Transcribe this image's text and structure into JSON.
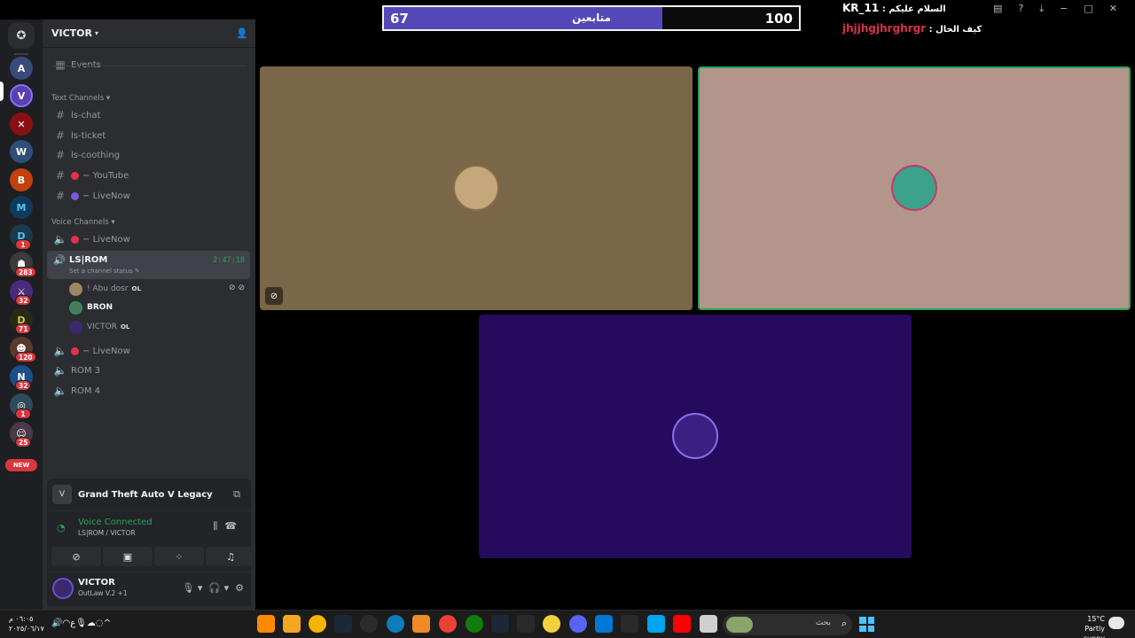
{
  "follow_goal": {
    "current": "67",
    "label": "متابعين",
    "goal": "100",
    "progress": 0.67,
    "fill_color": "#5448b8"
  },
  "chat_overlay": [
    {
      "user": "KR_11",
      "sep": " : ",
      "message": "السلام عليكم",
      "user_color": "#ffffff"
    },
    {
      "user": "jhjjhgjhrghrgr",
      "sep": " : ",
      "message": "كيف الحال",
      "user_color": "#d9304a"
    }
  ],
  "server_rail": {
    "badges": [
      "1",
      "283",
      "32",
      "71",
      "120",
      "32",
      "1",
      "25"
    ],
    "new_label": "NEW"
  },
  "sidebar": {
    "server_name": "VICTOR",
    "events_label": "Events",
    "text_category": "Text Channels",
    "text_channels": [
      "ls-chat",
      "ls-ticket",
      "ls-coothing",
      "YouTube",
      "LiveNow"
    ],
    "dash": "−",
    "voice_category": "Voice Channels",
    "voice_channels": {
      "top": "LiveNow",
      "active": {
        "name": "LS|ROM",
        "time": "2:47:18",
        "status_hint": "Set a channel status"
      },
      "members": [
        {
          "name": "! Abu dosr",
          "tag": "OL"
        },
        {
          "name": "BRON",
          "tag": ""
        },
        {
          "name": "VICTOR",
          "tag": "OL"
        }
      ],
      "after": [
        "LiveNow",
        "ROM 3",
        "ROM 4"
      ]
    }
  },
  "activity": {
    "game": "Grand Theft Auto V Legacy"
  },
  "voice": {
    "status": "Voice Connected",
    "location": "LS|ROM / VICTOR"
  },
  "user": {
    "name": "VICTOR",
    "status": "OutLaw V.2 +1"
  },
  "tiles": [
    {
      "bg": "#7a6648"
    },
    {
      "bg": "#b4958c"
    },
    {
      "bg": "#260a5e"
    }
  ],
  "taskbar": {
    "time": "٠٦:٠٥ م",
    "date": "٢٠٢٥/٠٦/١٧",
    "lang": "ع",
    "search_placeholder": "بحث",
    "temperature": "15°C",
    "weather": "Partly sunny"
  },
  "colors": {
    "accent": "#5865f2",
    "voice_green": "#23a559",
    "badge_red": "#da373c",
    "sidebar_bg": "#2b2d31",
    "rail_bg": "#1e1f22"
  }
}
